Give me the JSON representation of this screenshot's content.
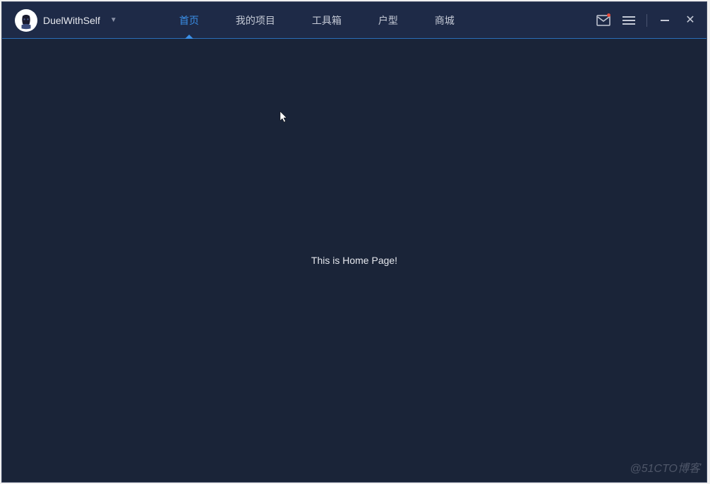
{
  "user": {
    "name": "DuelWithSelf"
  },
  "tabs": [
    {
      "label": "首页",
      "active": true
    },
    {
      "label": "我的项目",
      "active": false
    },
    {
      "label": "工具箱",
      "active": false
    },
    {
      "label": "户型",
      "active": false
    },
    {
      "label": "商城",
      "active": false
    }
  ],
  "content": {
    "home_text": "This is Home Page!"
  },
  "watermark": "@51CTO博客"
}
